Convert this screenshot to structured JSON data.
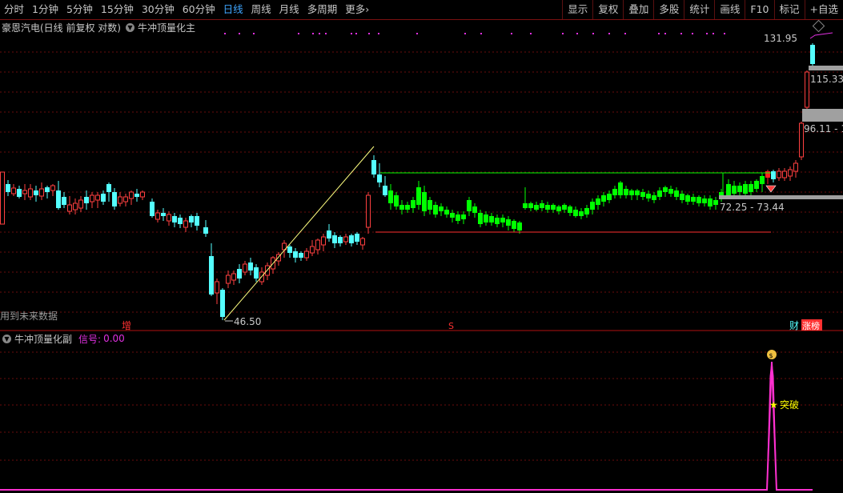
{
  "toolbar": {
    "periods": [
      "分时",
      "1分钟",
      "5分钟",
      "15分钟",
      "30分钟",
      "60分钟",
      "日线",
      "周线",
      "月线",
      "多周期",
      "更多"
    ],
    "active_period": "日线",
    "more_arrow": "›",
    "right_items": [
      "显示",
      "复权",
      "叠加",
      "多股",
      "统计",
      "画线",
      "F10",
      "标记",
      "+自选"
    ]
  },
  "chart": {
    "stock_title": "豪恩汽电(日线 前复权 对数)",
    "indicator_main": "牛冲顶量化主",
    "future_data_text": "用到未来数据",
    "price_high_label": "131.95",
    "price_low_label": "46.50",
    "box_label_1": "115.33",
    "box_label_2": "96.11 - 1",
    "range_label": "72.25 - 73.44",
    "marker_zeng": "增",
    "marker_s": "S",
    "marker_cai": "财",
    "marker_zhangbang": "涨榜"
  },
  "sub_chart": {
    "indicator_name": "牛冲顶量化副",
    "signal_label": "信号:",
    "signal_value": "0.00",
    "breakout_label": "突破",
    "money_icon": "money-bag-icon"
  },
  "colors": {
    "up": "#ff4040",
    "down": "#54ffff",
    "box_green": "#00ff00",
    "grid": "#7a1010",
    "signal": "#ff30d0",
    "yellow_line": "#ffff80"
  },
  "chart_data": {
    "type": "candlestick",
    "scale": "log",
    "annotations": [
      "131.95",
      "115.33",
      "96.11 - 1",
      "72.25 - 73.44",
      "46.50"
    ]
  }
}
